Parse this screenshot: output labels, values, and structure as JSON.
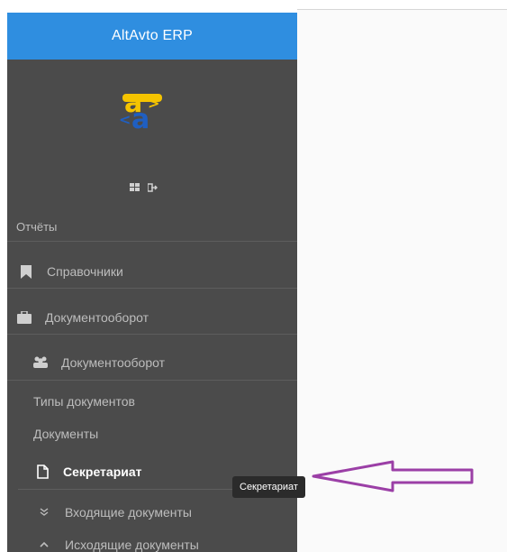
{
  "app": {
    "title": "AltAvto ERP"
  },
  "sidebar": {
    "reports_label": "Отчёты",
    "items": [
      {
        "label": "Справочники",
        "icon": "bookmark-icon"
      },
      {
        "label": "Документооборот",
        "icon": "briefcase-icon"
      }
    ],
    "submenu": {
      "group_label": "Документооборот",
      "group_icon": "users-icon",
      "links": [
        {
          "label": "Типы документов"
        },
        {
          "label": "Документы"
        }
      ],
      "active": {
        "label": "Секретариат",
        "icon": "file-icon"
      },
      "children": [
        {
          "label": "Входящие документы",
          "icon": "chevron-double-down-icon"
        },
        {
          "label": "Исходящие документы",
          "icon": "chevron-up-icon"
        }
      ]
    }
  },
  "tooltip": {
    "text": "Секретариат"
  },
  "annotation": {
    "color": "#9b3fa6"
  },
  "colors": {
    "header": "#2f8ee0",
    "sidebar": "#4b4b4b",
    "logo_yellow": "#f5c400",
    "logo_blue": "#1f5fc2"
  }
}
